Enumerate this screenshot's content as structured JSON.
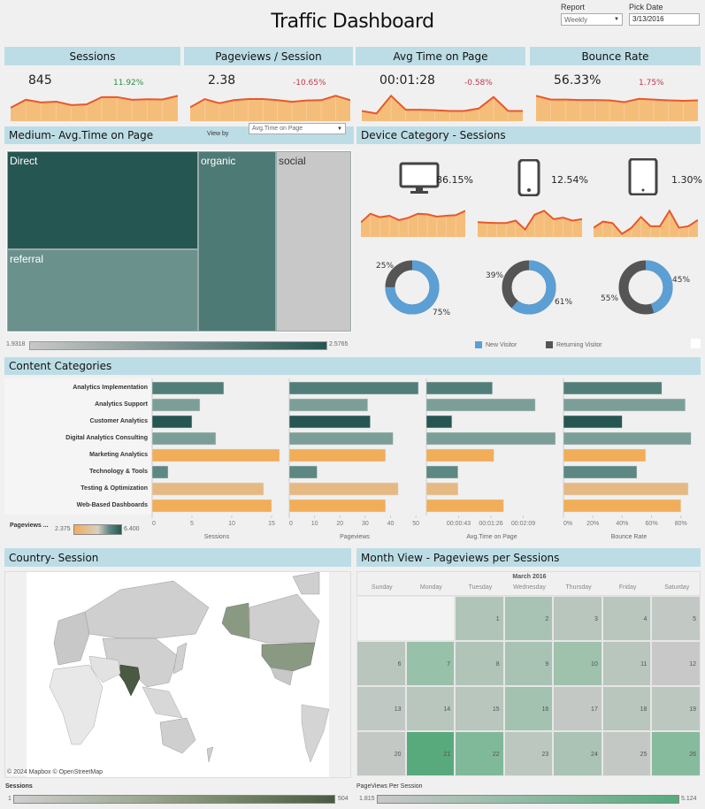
{
  "header": {
    "title": "Traffic Dashboard",
    "report_label": "Report",
    "report_value": "Weekly",
    "date_label": "Pick Date",
    "date_value": "3/13/2016"
  },
  "kpis": [
    {
      "title": "Sessions",
      "value": "845",
      "change": "11.92%",
      "trend": "positive",
      "spark": [
        5,
        8,
        7,
        7.3,
        6,
        6.3,
        9,
        9,
        8,
        8.2,
        8.1,
        9.5
      ]
    },
    {
      "title": "Pageviews / Session",
      "value": "2.38",
      "change": "-10.65%",
      "trend": "negative",
      "spark": [
        5,
        8,
        6.5,
        7.6,
        8,
        8,
        7.6,
        7,
        7.5,
        7.6,
        9.2,
        7.6
      ]
    },
    {
      "title": "Avg Time on Page",
      "value": "00:01:28",
      "change": "-0.58%",
      "trend": "negative",
      "spark": [
        4,
        3,
        10,
        4.5,
        4.5,
        4.3,
        4,
        4,
        5,
        9.5,
        4,
        4
      ]
    },
    {
      "title": "Bounce Rate",
      "value": "56.33%",
      "change": "1.75%",
      "trend": "negative",
      "spark": [
        10,
        8.5,
        8.5,
        8.3,
        8.3,
        8.2,
        7.5,
        8.8,
        8.5,
        8.2,
        8,
        8.2
      ]
    }
  ],
  "medium": {
    "title": "Medium- Avg.Time on Page",
    "view_by_label": "View by",
    "view_by_value": "Avg.Time on Page",
    "items": [
      {
        "label": "Direct",
        "color": "#265652"
      },
      {
        "label": "referral",
        "color": "#6a918c"
      },
      {
        "label": "organic",
        "color": "#4d7a75"
      },
      {
        "label": "social",
        "color": "#c8c8c8"
      }
    ],
    "legend_min": "1.9318",
    "legend_max": "2.5765"
  },
  "device": {
    "title": "Device Category - Sessions",
    "items": [
      {
        "name": "Desktop",
        "icon": "desktop-icon",
        "share": "86.15%",
        "new_pct": 75,
        "returning_pct": 25,
        "new_label": "75%",
        "ret_label": "25%",
        "spark": [
          5,
          8,
          6.8,
          7.3,
          5.8,
          6.6,
          8,
          7.8,
          7,
          7.3,
          7.5,
          9
        ]
      },
      {
        "name": "Mobile",
        "icon": "mobile-icon",
        "share": "12.54%",
        "new_pct": 61,
        "returning_pct": 39,
        "new_label": "61%",
        "ret_label": "39%",
        "spark": [
          5,
          4.8,
          4.7,
          4.7,
          5.5,
          2.5,
          7.5,
          8.8,
          6,
          6.5,
          5.5,
          6
        ]
      },
      {
        "name": "Tablet",
        "icon": "tablet-icon",
        "share": "1.30%",
        "new_pct": 45,
        "returning_pct": 55,
        "new_label": "45%",
        "ret_label": "55%",
        "spark": [
          3,
          5,
          4.5,
          1,
          3,
          6.5,
          3.5,
          3.5,
          8.5,
          3,
          3.5,
          5.5
        ]
      }
    ],
    "legend": [
      {
        "label": "New Visitor",
        "color": "#5b9fd4"
      },
      {
        "label": "Returning Visitor",
        "color": "#555555"
      }
    ]
  },
  "content": {
    "title": "Content Categories",
    "categories": [
      "Analytics Implementation",
      "Analytics Support",
      "Customer Analytics",
      "Digital Analytics Consulting",
      "Marketing Analytics",
      "Technology & Tools",
      "Testing & Optimization",
      "Web-Based Dashboards"
    ],
    "colors": [
      "#527e79",
      "#7c9e99",
      "#265652",
      "#7c9e99",
      "#f2ad58",
      "#5c8782",
      "#e6b983",
      "#f2ad58"
    ],
    "charts": [
      {
        "axis_title": "Sessions",
        "max": 16,
        "ticks": [
          "0",
          "5",
          "10",
          "15"
        ],
        "tick_vals": [
          0,
          5,
          10,
          15
        ],
        "values": [
          9,
          6,
          5,
          8,
          16,
          2,
          14,
          15
        ]
      },
      {
        "axis_title": "Pageviews",
        "max": 51,
        "ticks": [
          "0",
          "10",
          "20",
          "30",
          "40",
          "50"
        ],
        "tick_vals": [
          0,
          10,
          20,
          30,
          40,
          50
        ],
        "values": [
          51,
          31,
          32,
          41,
          38,
          11,
          43,
          38
        ]
      },
      {
        "axis_title": "Avg.Time on Page",
        "max": 172,
        "ticks": [
          "00:00:43",
          "00:01:26",
          "00:02:09"
        ],
        "tick_vals": [
          43,
          86,
          129
        ],
        "values": [
          88,
          145,
          34,
          172,
          90,
          42,
          42,
          103
        ]
      },
      {
        "axis_title": "Bounce Rate",
        "max": 88,
        "ticks": [
          "0%",
          "20%",
          "40%",
          "60%",
          "80%"
        ],
        "tick_vals": [
          0,
          20,
          40,
          60,
          80
        ],
        "values": [
          67,
          83,
          40,
          87,
          56,
          50,
          85,
          80
        ]
      }
    ],
    "legend_title": "Pageviews ...",
    "legend_min": "2.375",
    "legend_max": "6.400"
  },
  "country": {
    "title": "Country- Session",
    "attribution": "© 2024 Mapbox  © OpenStreetMap",
    "legend_title": "Sessions",
    "legend_min": "1",
    "legend_max": "504"
  },
  "calendar": {
    "title": "Month View - Pageviews per Sessions",
    "month": "March 2016",
    "weekdays": [
      "Sunday",
      "Monday",
      "Tuesday",
      "Wednesday",
      "Thursday",
      "Friday",
      "Saturday"
    ],
    "days": [
      {
        "d": "1",
        "c": "#b0c5b8"
      },
      {
        "d": "2",
        "c": "#a8c3b4"
      },
      {
        "d": "3",
        "c": "#b8c6bd"
      },
      {
        "d": "4",
        "c": "#b8c6bd"
      },
      {
        "d": "5",
        "c": "#c2c8c4"
      },
      {
        "d": "6",
        "c": "#b8c6bd"
      },
      {
        "d": "7",
        "c": "#98c1a9"
      },
      {
        "d": "8",
        "c": "#b0c5b8"
      },
      {
        "d": "9",
        "c": "#a8c3b4"
      },
      {
        "d": "10",
        "c": "#9ec2ac"
      },
      {
        "d": "11",
        "c": "#b8c6bd"
      },
      {
        "d": "12",
        "c": "#c8c8c8"
      },
      {
        "d": "13",
        "c": "#c0c8c3"
      },
      {
        "d": "14",
        "c": "#b8c6bd"
      },
      {
        "d": "15",
        "c": "#b8c6bd"
      },
      {
        "d": "16",
        "c": "#a4c2b0"
      },
      {
        "d": "17",
        "c": "#c4c8c5"
      },
      {
        "d": "18",
        "c": "#b8c6bd"
      },
      {
        "d": "19",
        "c": "#bcc7c0"
      },
      {
        "d": "20",
        "c": "#c4c8c5"
      },
      {
        "d": "21",
        "c": "#58aa7d"
      },
      {
        "d": "22",
        "c": "#80b99a"
      },
      {
        "d": "23",
        "c": "#bcc7c0"
      },
      {
        "d": "24",
        "c": "#aac3b5"
      },
      {
        "d": "25",
        "c": "#c4c8c5"
      },
      {
        "d": "26",
        "c": "#86bb9e"
      }
    ],
    "legend_title": "PageViews Per Session",
    "legend_min": "1.815",
    "legend_max": "5.124"
  }
}
